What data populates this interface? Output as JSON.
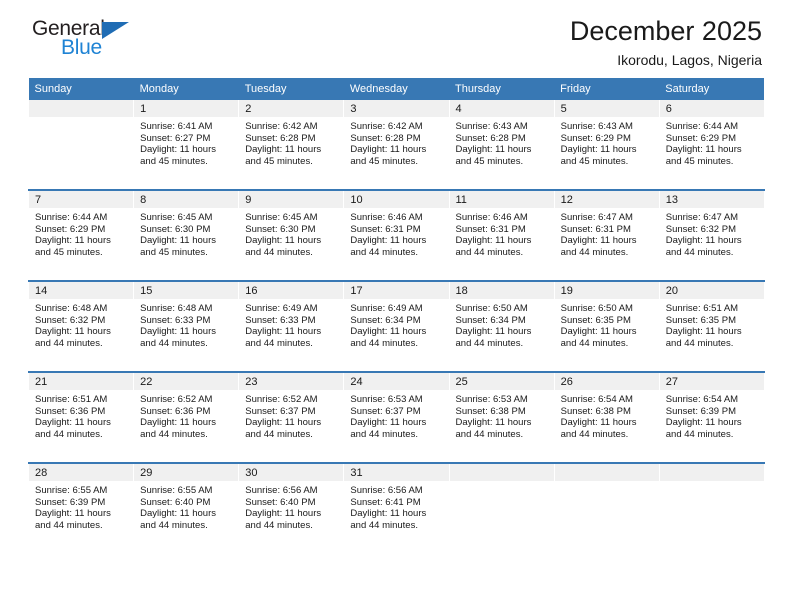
{
  "logo": {
    "word_top": "General",
    "word_bottom": "Blue",
    "triangle_color": "#1f6cb4",
    "blue_text_color": "#1f83d4",
    "icon": "general-blue-logo"
  },
  "header": {
    "title": "December 2025",
    "subtitle": "Ikorodu, Lagos, Nigeria"
  },
  "theme": {
    "header_row_bg": "#3878b4",
    "header_row_text": "#ffffff",
    "daynum_band_bg": "#f0f0f0",
    "page_bg": "#ffffff",
    "body_text": "#1a1a1a"
  },
  "weekday_headers": [
    "Sunday",
    "Monday",
    "Tuesday",
    "Wednesday",
    "Thursday",
    "Friday",
    "Saturday"
  ],
  "labels": {
    "sunrise_prefix": "Sunrise:",
    "sunset_prefix": "Sunset:",
    "daylight_prefix": "Daylight:"
  },
  "weeks": [
    [
      {
        "day": "",
        "empty": true
      },
      {
        "day": "1",
        "sunrise": "Sunrise: 6:41 AM",
        "sunset": "Sunset: 6:27 PM",
        "daylight_l1": "Daylight: 11 hours",
        "daylight_l2": "and 45 minutes."
      },
      {
        "day": "2",
        "sunrise": "Sunrise: 6:42 AM",
        "sunset": "Sunset: 6:28 PM",
        "daylight_l1": "Daylight: 11 hours",
        "daylight_l2": "and 45 minutes."
      },
      {
        "day": "3",
        "sunrise": "Sunrise: 6:42 AM",
        "sunset": "Sunset: 6:28 PM",
        "daylight_l1": "Daylight: 11 hours",
        "daylight_l2": "and 45 minutes."
      },
      {
        "day": "4",
        "sunrise": "Sunrise: 6:43 AM",
        "sunset": "Sunset: 6:28 PM",
        "daylight_l1": "Daylight: 11 hours",
        "daylight_l2": "and 45 minutes."
      },
      {
        "day": "5",
        "sunrise": "Sunrise: 6:43 AM",
        "sunset": "Sunset: 6:29 PM",
        "daylight_l1": "Daylight: 11 hours",
        "daylight_l2": "and 45 minutes."
      },
      {
        "day": "6",
        "sunrise": "Sunrise: 6:44 AM",
        "sunset": "Sunset: 6:29 PM",
        "daylight_l1": "Daylight: 11 hours",
        "daylight_l2": "and 45 minutes."
      }
    ],
    [
      {
        "day": "7",
        "sunrise": "Sunrise: 6:44 AM",
        "sunset": "Sunset: 6:29 PM",
        "daylight_l1": "Daylight: 11 hours",
        "daylight_l2": "and 45 minutes."
      },
      {
        "day": "8",
        "sunrise": "Sunrise: 6:45 AM",
        "sunset": "Sunset: 6:30 PM",
        "daylight_l1": "Daylight: 11 hours",
        "daylight_l2": "and 45 minutes."
      },
      {
        "day": "9",
        "sunrise": "Sunrise: 6:45 AM",
        "sunset": "Sunset: 6:30 PM",
        "daylight_l1": "Daylight: 11 hours",
        "daylight_l2": "and 44 minutes."
      },
      {
        "day": "10",
        "sunrise": "Sunrise: 6:46 AM",
        "sunset": "Sunset: 6:31 PM",
        "daylight_l1": "Daylight: 11 hours",
        "daylight_l2": "and 44 minutes."
      },
      {
        "day": "11",
        "sunrise": "Sunrise: 6:46 AM",
        "sunset": "Sunset: 6:31 PM",
        "daylight_l1": "Daylight: 11 hours",
        "daylight_l2": "and 44 minutes."
      },
      {
        "day": "12",
        "sunrise": "Sunrise: 6:47 AM",
        "sunset": "Sunset: 6:31 PM",
        "daylight_l1": "Daylight: 11 hours",
        "daylight_l2": "and 44 minutes."
      },
      {
        "day": "13",
        "sunrise": "Sunrise: 6:47 AM",
        "sunset": "Sunset: 6:32 PM",
        "daylight_l1": "Daylight: 11 hours",
        "daylight_l2": "and 44 minutes."
      }
    ],
    [
      {
        "day": "14",
        "sunrise": "Sunrise: 6:48 AM",
        "sunset": "Sunset: 6:32 PM",
        "daylight_l1": "Daylight: 11 hours",
        "daylight_l2": "and 44 minutes."
      },
      {
        "day": "15",
        "sunrise": "Sunrise: 6:48 AM",
        "sunset": "Sunset: 6:33 PM",
        "daylight_l1": "Daylight: 11 hours",
        "daylight_l2": "and 44 minutes."
      },
      {
        "day": "16",
        "sunrise": "Sunrise: 6:49 AM",
        "sunset": "Sunset: 6:33 PM",
        "daylight_l1": "Daylight: 11 hours",
        "daylight_l2": "and 44 minutes."
      },
      {
        "day": "17",
        "sunrise": "Sunrise: 6:49 AM",
        "sunset": "Sunset: 6:34 PM",
        "daylight_l1": "Daylight: 11 hours",
        "daylight_l2": "and 44 minutes."
      },
      {
        "day": "18",
        "sunrise": "Sunrise: 6:50 AM",
        "sunset": "Sunset: 6:34 PM",
        "daylight_l1": "Daylight: 11 hours",
        "daylight_l2": "and 44 minutes."
      },
      {
        "day": "19",
        "sunrise": "Sunrise: 6:50 AM",
        "sunset": "Sunset: 6:35 PM",
        "daylight_l1": "Daylight: 11 hours",
        "daylight_l2": "and 44 minutes."
      },
      {
        "day": "20",
        "sunrise": "Sunrise: 6:51 AM",
        "sunset": "Sunset: 6:35 PM",
        "daylight_l1": "Daylight: 11 hours",
        "daylight_l2": "and 44 minutes."
      }
    ],
    [
      {
        "day": "21",
        "sunrise": "Sunrise: 6:51 AM",
        "sunset": "Sunset: 6:36 PM",
        "daylight_l1": "Daylight: 11 hours",
        "daylight_l2": "and 44 minutes."
      },
      {
        "day": "22",
        "sunrise": "Sunrise: 6:52 AM",
        "sunset": "Sunset: 6:36 PM",
        "daylight_l1": "Daylight: 11 hours",
        "daylight_l2": "and 44 minutes."
      },
      {
        "day": "23",
        "sunrise": "Sunrise: 6:52 AM",
        "sunset": "Sunset: 6:37 PM",
        "daylight_l1": "Daylight: 11 hours",
        "daylight_l2": "and 44 minutes."
      },
      {
        "day": "24",
        "sunrise": "Sunrise: 6:53 AM",
        "sunset": "Sunset: 6:37 PM",
        "daylight_l1": "Daylight: 11 hours",
        "daylight_l2": "and 44 minutes."
      },
      {
        "day": "25",
        "sunrise": "Sunrise: 6:53 AM",
        "sunset": "Sunset: 6:38 PM",
        "daylight_l1": "Daylight: 11 hours",
        "daylight_l2": "and 44 minutes."
      },
      {
        "day": "26",
        "sunrise": "Sunrise: 6:54 AM",
        "sunset": "Sunset: 6:38 PM",
        "daylight_l1": "Daylight: 11 hours",
        "daylight_l2": "and 44 minutes."
      },
      {
        "day": "27",
        "sunrise": "Sunrise: 6:54 AM",
        "sunset": "Sunset: 6:39 PM",
        "daylight_l1": "Daylight: 11 hours",
        "daylight_l2": "and 44 minutes."
      }
    ],
    [
      {
        "day": "28",
        "sunrise": "Sunrise: 6:55 AM",
        "sunset": "Sunset: 6:39 PM",
        "daylight_l1": "Daylight: 11 hours",
        "daylight_l2": "and 44 minutes."
      },
      {
        "day": "29",
        "sunrise": "Sunrise: 6:55 AM",
        "sunset": "Sunset: 6:40 PM",
        "daylight_l1": "Daylight: 11 hours",
        "daylight_l2": "and 44 minutes."
      },
      {
        "day": "30",
        "sunrise": "Sunrise: 6:56 AM",
        "sunset": "Sunset: 6:40 PM",
        "daylight_l1": "Daylight: 11 hours",
        "daylight_l2": "and 44 minutes."
      },
      {
        "day": "31",
        "sunrise": "Sunrise: 6:56 AM",
        "sunset": "Sunset: 6:41 PM",
        "daylight_l1": "Daylight: 11 hours",
        "daylight_l2": "and 44 minutes."
      },
      {
        "day": "",
        "empty": true
      },
      {
        "day": "",
        "empty": true
      },
      {
        "day": "",
        "empty": true
      }
    ]
  ]
}
